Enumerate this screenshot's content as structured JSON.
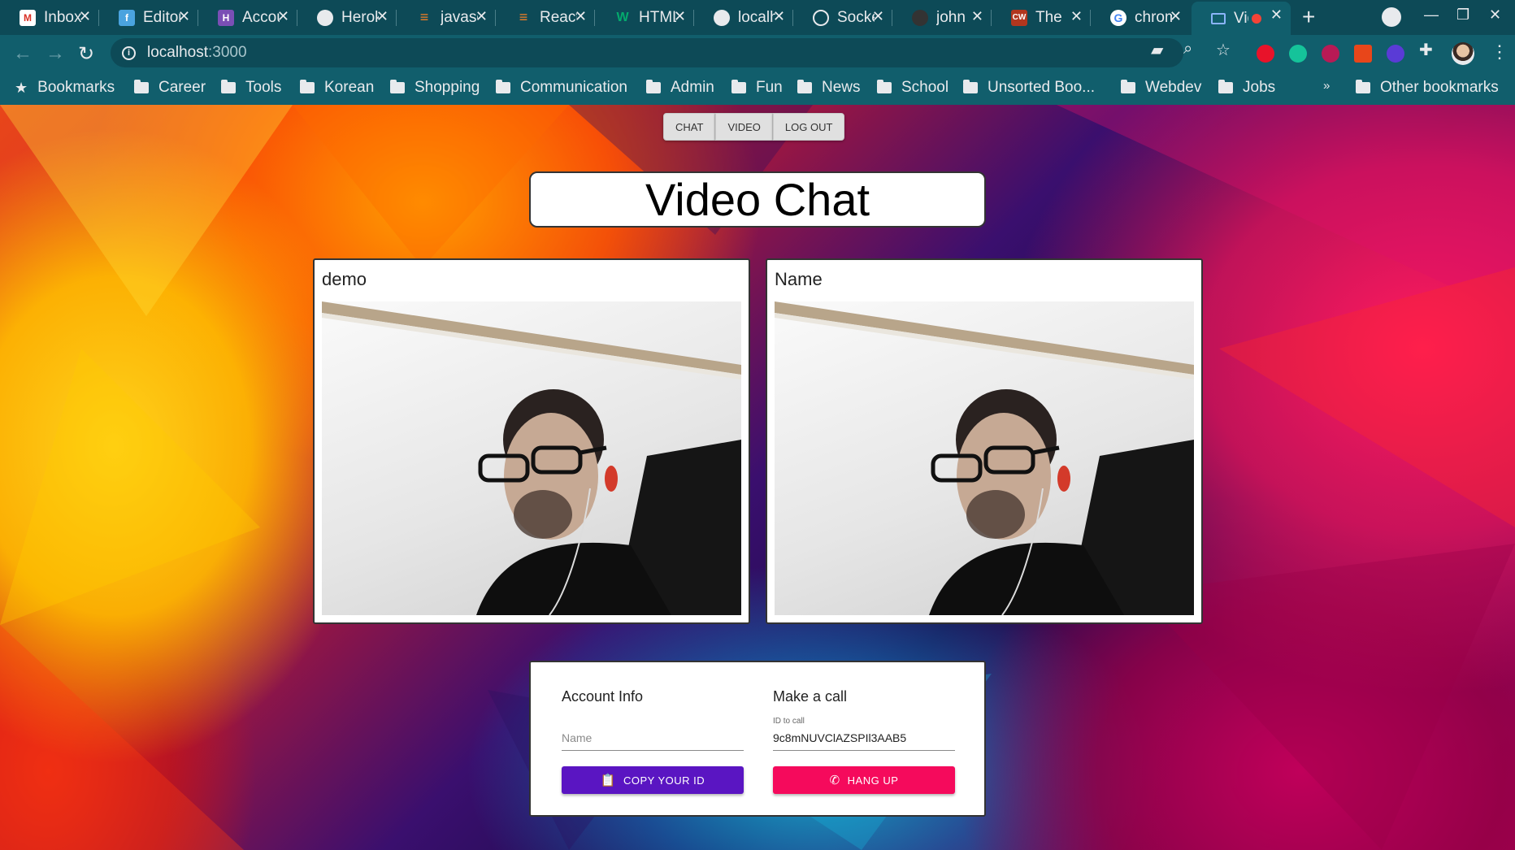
{
  "browser": {
    "tabs": [
      {
        "title": "Inbox",
        "icon": "gmail-icon",
        "color": "#d93025"
      },
      {
        "title": "Editor",
        "icon": "flo-icon",
        "color": "#4aa3df"
      },
      {
        "title": "Account",
        "icon": "heroku-icon",
        "color": "#7a4fb5"
      },
      {
        "title": "Heroku",
        "icon": "globe-icon",
        "color": "#e8eaed"
      },
      {
        "title": "javascript",
        "icon": "stackoverflow-icon",
        "color": "#f48024"
      },
      {
        "title": "React",
        "icon": "stackoverflow-icon",
        "color": "#f48024"
      },
      {
        "title": "HTML",
        "icon": "w3schools-icon",
        "color": "#04aa6d"
      },
      {
        "title": "localhost",
        "icon": "globe-icon",
        "color": "#e8eaed"
      },
      {
        "title": "Socket",
        "icon": "socketio-icon",
        "color": "#e8eaed"
      },
      {
        "title": "john",
        "icon": "github-icon",
        "color": "#333333"
      },
      {
        "title": "The",
        "icon": "codewars-icon",
        "color": "#b1361e"
      },
      {
        "title": "chrome",
        "icon": "google-icon",
        "color": "#ffffff"
      },
      {
        "title": "Video Chat",
        "icon": "app-icon",
        "color": "#8ab4f8",
        "active": true
      }
    ],
    "new_tab": "+",
    "url_host": "localhost",
    "url_port": ":3000",
    "bookmarks_label": "Bookmarks",
    "bookmarks": [
      "Career",
      "Tools",
      "Korean",
      "Shopping",
      "Communication",
      "Admin",
      "Fun",
      "News",
      "School",
      "Unsorted Boo...",
      "Webdev",
      "Jobs"
    ],
    "overflow": "»",
    "other_bookmarks": "Other bookmarks"
  },
  "app": {
    "nav": [
      "CHAT",
      "VIDEO",
      "LOG OUT"
    ],
    "title": "Video Chat",
    "videos": [
      {
        "label": "demo"
      },
      {
        "label": "Name"
      }
    ],
    "account": {
      "heading": "Account Info",
      "name_placeholder": "Name",
      "copy_button": "COPY YOUR ID"
    },
    "call": {
      "heading": "Make a call",
      "id_label": "ID to call",
      "id_value": "9c8mNUVClAZSPIl3AAB5",
      "hangup_button": "HANG UP"
    },
    "colors": {
      "primary": "#5a15c2",
      "secondary": "#f50a5c"
    }
  }
}
